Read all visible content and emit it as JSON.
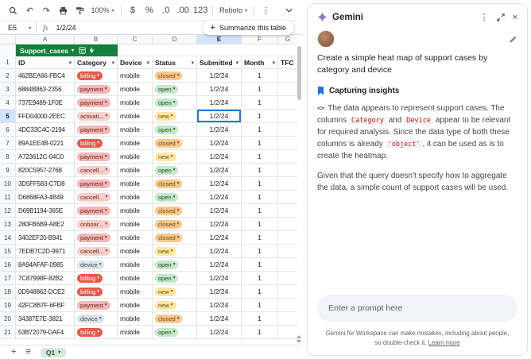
{
  "colors": {
    "table_green": "#12813b",
    "selection_blue": "#1a73e8",
    "selection_bg": "#d3e3fd"
  },
  "toolbar": {
    "zoom": "100%",
    "currency": "$",
    "percent": "%",
    "dec_decrease": ".0",
    "dec_increase": ".00",
    "format_123": "123",
    "font": "Roboto"
  },
  "formula_bar": {
    "cell_ref": "E5",
    "fx_label": "fx",
    "value": "1/2/24"
  },
  "summarize": {
    "label": "Summarize this table"
  },
  "table": {
    "name": "Support_cases"
  },
  "sheet": {
    "col_letters": [
      "A",
      "B",
      "C",
      "D",
      "E",
      "F",
      "G"
    ],
    "selected": {
      "ref": "E5",
      "col": "E",
      "row": 5
    },
    "headers": [
      "ID",
      "Category",
      "Device",
      "Status",
      "Submitted",
      "Month",
      "TFC"
    ],
    "rows": [
      {
        "num": 2,
        "id": "462BEA66-FBC4",
        "category": "billing",
        "device": "mobile",
        "status": "closed",
        "submitted": "1/2/24",
        "month": "1"
      },
      {
        "num": 3,
        "id": "6884B863-2356",
        "category": "payment",
        "device": "mobile",
        "status": "open",
        "submitted": "1/2/24",
        "month": "1"
      },
      {
        "num": 4,
        "id": "737E9489-1F0E",
        "category": "payment",
        "device": "mobile",
        "status": "open",
        "submitted": "1/2/24",
        "month": "1"
      },
      {
        "num": 5,
        "id": "FFD04000-2EEC",
        "category": "activati...",
        "device": "mobile",
        "status": "new",
        "submitted": "1/2/24",
        "month": "1"
      },
      {
        "num": 6,
        "id": "4DC33C4C-2194",
        "category": "payment",
        "device": "mobile",
        "status": "open",
        "submitted": "1/2/24",
        "month": "1"
      },
      {
        "num": 7,
        "id": "89A1EE4B-0221",
        "category": "billing",
        "device": "mobile",
        "status": "closed",
        "submitted": "1/2/24",
        "month": "1"
      },
      {
        "num": 8,
        "id": "A723612C-04C0",
        "category": "payment",
        "device": "mobile",
        "status": "new",
        "submitted": "1/2/24",
        "month": "1"
      },
      {
        "num": 9,
        "id": "820C5957-2768",
        "category": "cancell...",
        "device": "mobile",
        "status": "open",
        "submitted": "1/2/24",
        "month": "1"
      },
      {
        "num": 10,
        "id": "3D5FF583-C7D8",
        "category": "payment",
        "device": "mobile",
        "status": "closed",
        "submitted": "1/2/24",
        "month": "1"
      },
      {
        "num": 11,
        "id": "D6868FA3-4B49",
        "category": "cancell...",
        "device": "mobile",
        "status": "open",
        "submitted": "1/2/24",
        "month": "1"
      },
      {
        "num": 12,
        "id": "D69B1194-365E",
        "category": "payment",
        "device": "mobile",
        "status": "closed",
        "submitted": "1/2/24",
        "month": "1"
      },
      {
        "num": 13,
        "id": "280FB6B9-A8E2",
        "category": "onboar...",
        "device": "mobile",
        "status": "closed",
        "submitted": "1/2/24",
        "month": "1"
      },
      {
        "num": 14,
        "id": "3402EF20-B941",
        "category": "payment",
        "device": "mobile",
        "status": "closed",
        "submitted": "1/2/24",
        "month": "1"
      },
      {
        "num": 15,
        "id": "7EDB7C2D-9971",
        "category": "cancell...",
        "device": "mobile",
        "status": "new",
        "submitted": "1/2/24",
        "month": "1"
      },
      {
        "num": 16,
        "id": "8A94AFAF-0985",
        "category": "device",
        "device": "mobile",
        "status": "open",
        "submitted": "1/2/24",
        "month": "1"
      },
      {
        "num": 17,
        "id": "7C87998F-82B2",
        "category": "billing",
        "device": "mobile",
        "status": "open",
        "submitted": "1/2/24",
        "month": "1"
      },
      {
        "num": 18,
        "id": "0D948862-DCE2",
        "category": "billing",
        "device": "mobile",
        "status": "new",
        "submitted": "1/2/24",
        "month": "1"
      },
      {
        "num": 19,
        "id": "42FC8B7F-6FBF",
        "category": "payment",
        "device": "mobile",
        "status": "new",
        "submitted": "1/2/24",
        "month": "1"
      },
      {
        "num": 20,
        "id": "34387E7E-3821",
        "category": "device",
        "device": "mobile",
        "status": "closed",
        "submitted": "1/2/24",
        "month": "1"
      },
      {
        "num": 21,
        "id": "53B72079-DAF4",
        "category": "billing",
        "device": "mobile",
        "status": "open",
        "submitted": "1/2/24",
        "month": "1"
      }
    ]
  },
  "chip_styles": {
    "billing": {
      "bg": "#e8584c",
      "fg": "#ffffff"
    },
    "payment": {
      "bg": "#f2b8b5",
      "fg": "#6e1d17"
    },
    "activati...": {
      "bg": "#f6d0cd",
      "fg": "#6e1d17"
    },
    "cancell...": {
      "bg": "#f6d0cd",
      "fg": "#6e1d17"
    },
    "onboar...": {
      "bg": "#f6d0cd",
      "fg": "#6e1d17"
    },
    "device": {
      "bg": "#dde3ea",
      "fg": "#41484f"
    },
    "closed": {
      "bg": "#f8c98a",
      "fg": "#70451a"
    },
    "open": {
      "bg": "#c4e8c9",
      "fg": "#1e4620"
    },
    "new": {
      "bg": "#fbe7a2",
      "fg": "#5f4d00"
    }
  },
  "bottom_bar": {
    "tab": "Q1"
  },
  "gemini": {
    "title": "Gemini",
    "prompt": "Create a simple heat map of support cases by category and device",
    "status_label": "Capturing insights",
    "analysis_parts": [
      "The data appears to represent support cases. The columns ",
      "Category",
      " and ",
      "Device",
      " appear to be relevant for required analysis. Since the data type of both these columns is already ",
      "'object'",
      ", it can be used as is to create the heatmap."
    ],
    "analysis_p2": "Given that the query doesn't specify how to aggregate the data, a simple count of support cases will be used.",
    "input_placeholder": "Enter a prompt here",
    "disclaimer": "Gemini for Workspace can make mistakes, including about people, so double-check it.",
    "learn_more": "Learn more"
  }
}
